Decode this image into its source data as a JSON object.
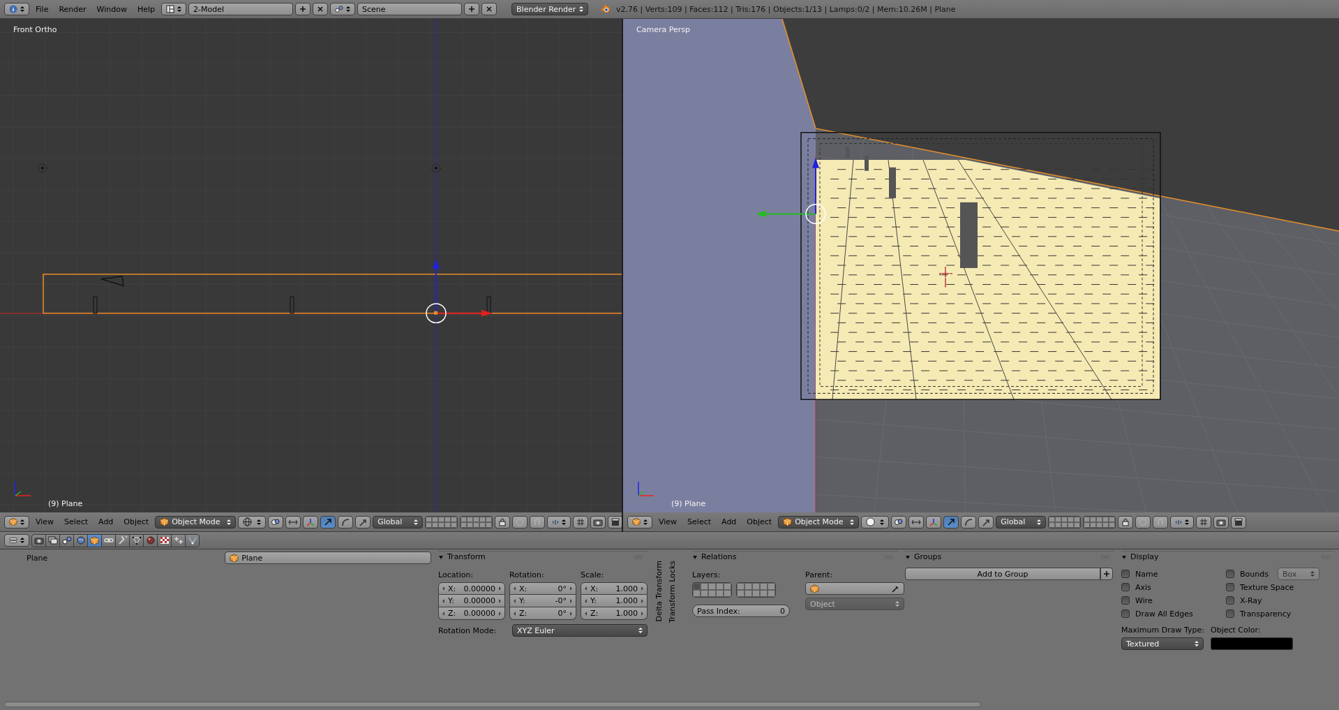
{
  "top_bar": {
    "menus": [
      "File",
      "Render",
      "Window",
      "Help"
    ],
    "screen_layout": "2-Model",
    "scene": "Scene",
    "render_engine": "Blender Render",
    "stats": "v2.76 | Verts:109 | Faces:112 | Tris:176 | Objects:1/13 | Lamps:0/2 | Mem:10.26M | Plane"
  },
  "viewports": [
    {
      "kind": "ortho",
      "view_name": "Front Ortho",
      "object_info": "(9) Plane",
      "menus": [
        "View",
        "Select",
        "Add",
        "Object"
      ],
      "mode": "Object Mode",
      "shading": {
        "kind": "wireframe"
      },
      "orientation": "Global"
    },
    {
      "kind": "camera",
      "view_name": "Camera Persp",
      "object_info": "(9) Plane",
      "menus": [
        "View",
        "Select",
        "Add",
        "Object"
      ],
      "mode": "Object Mode",
      "shading": {
        "kind": "solid"
      },
      "orientation": "Global"
    }
  ],
  "properties": {
    "tabs": [
      {
        "kind": "render",
        "selected": false
      },
      {
        "kind": "layers",
        "selected": false
      },
      {
        "kind": "scene",
        "selected": false
      },
      {
        "kind": "world",
        "selected": false
      },
      {
        "kind": "object",
        "selected": true
      },
      {
        "kind": "constraints",
        "selected": false
      },
      {
        "kind": "modifiers",
        "selected": false
      },
      {
        "kind": "data",
        "selected": false
      },
      {
        "kind": "material",
        "selected": false
      },
      {
        "kind": "texture",
        "selected": false
      },
      {
        "kind": "particles",
        "selected": false
      },
      {
        "kind": "physics",
        "selected": false
      }
    ],
    "context_path": "Plane",
    "object_name": "Plane",
    "transform": {
      "title": "Transform",
      "location_label": "Location:",
      "rotation_label": "Rotation:",
      "scale_label": "Scale:",
      "location": [
        {
          "axis": "X:",
          "value": "0.00000"
        },
        {
          "axis": "Y:",
          "value": "0.00000"
        },
        {
          "axis": "Z:",
          "value": "0.00000"
        }
      ],
      "rotation": [
        {
          "axis": "X:",
          "value": "0°"
        },
        {
          "axis": "Y:",
          "value": "-0°"
        },
        {
          "axis": "Z:",
          "value": "0°"
        }
      ],
      "scale": [
        {
          "axis": "X:",
          "value": "1.000"
        },
        {
          "axis": "Y:",
          "value": "1.000"
        },
        {
          "axis": "Z:",
          "value": "1.000"
        }
      ],
      "rotation_mode_label": "Rotation Mode:",
      "rotation_mode": "XYZ Euler"
    },
    "collapsed_panels": [
      "Delta Transform",
      "Transform Locks"
    ],
    "relations": {
      "title": "Relations",
      "layers_label": "Layers:",
      "layers": [
        {
          "on": true
        },
        {
          "on": false
        },
        {
          "on": false
        },
        {
          "on": false
        },
        {
          "on": false
        },
        {
          "on": false
        },
        {
          "on": false
        },
        {
          "on": false
        },
        {
          "on": false
        },
        {
          "on": false
        },
        {
          "on": false
        },
        {
          "on": false
        },
        {
          "on": false
        },
        {
          "on": false
        },
        {
          "on": false
        },
        {
          "on": false
        },
        {
          "on": false
        },
        {
          "on": false
        },
        {
          "on": false
        },
        {
          "on": false
        }
      ],
      "parent_label": "Parent:",
      "parent_type": "Object",
      "pass_index_label": "Pass Index:",
      "pass_index": "0"
    },
    "groups": {
      "title": "Groups",
      "add_button": "Add to Group"
    },
    "display": {
      "title": "Display",
      "columns": [
        [
          {
            "label": "Name",
            "checked": false
          },
          {
            "label": "Axis",
            "checked": false
          },
          {
            "label": "Wire",
            "checked": false
          },
          {
            "label": "Draw All Edges",
            "checked": false
          }
        ],
        [
          {
            "label": "Bounds",
            "checked": false
          },
          {
            "label": "Texture Space",
            "checked": false
          },
          {
            "label": "X-Ray",
            "checked": false
          },
          {
            "label": "Transparency",
            "checked": false
          }
        ]
      ],
      "bounds_type": "Box",
      "max_draw_type_label": "Maximum Draw Type:",
      "max_draw_type": "Textured",
      "object_color_label": "Object Color:",
      "object_color": {
        "color": "#000000"
      }
    }
  }
}
